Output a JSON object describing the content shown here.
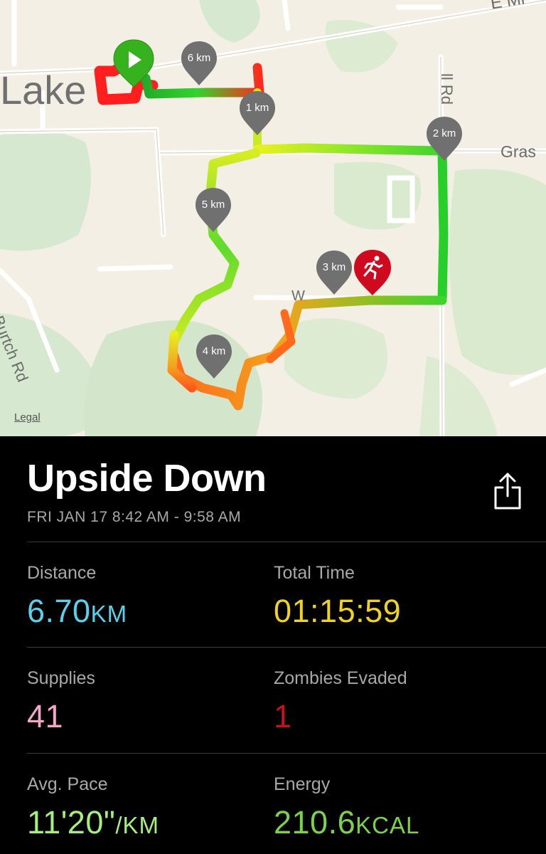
{
  "map": {
    "place_labels": {
      "town": "Lake",
      "road_top": "E Mi",
      "road_ll": "ll Rd",
      "road_gras": "Gras",
      "road_burtch": "Burtch Rd",
      "road_mid": "W"
    },
    "legal_label": "Legal",
    "km_markers": [
      "1 km",
      "2 km",
      "3 km",
      "4 km",
      "5 km",
      "6 km"
    ],
    "colors": {
      "route_green": "#22d02a",
      "route_yellow": "#e8ef1a",
      "route_orange": "#ff7a1c",
      "route_red": "#ff2020",
      "start_pin": "#35b21d",
      "zombie_pin": "#cf0a1f",
      "km_pin": "#707070"
    },
    "icons": {
      "start": "play-icon",
      "zombie": "running-person-icon"
    }
  },
  "run": {
    "title": "Upside Down",
    "date_range": "FRI JAN 17 8:42 AM - 9:58 AM",
    "share_icon": "share-icon"
  },
  "stats": {
    "distance": {
      "label": "Distance",
      "value": "6.70",
      "unit": "KM",
      "color": "#5ad1ea"
    },
    "total_time": {
      "label": "Total Time",
      "value": "01:15:59",
      "unit": "",
      "color": "#f0d31d"
    },
    "supplies": {
      "label": "Supplies",
      "value": "41",
      "unit": "",
      "color": "#f4a6c8"
    },
    "zombies_evaded": {
      "label": "Zombies Evaded",
      "value": "1",
      "unit": "",
      "color": "#c11620"
    },
    "avg_pace": {
      "label": "Avg. Pace",
      "value": "11'20\"",
      "unit": "/KM",
      "color": "#a4f07a"
    },
    "energy": {
      "label": "Energy",
      "value": "210.6",
      "unit": "KCAL",
      "color": "#7bd34a"
    }
  }
}
